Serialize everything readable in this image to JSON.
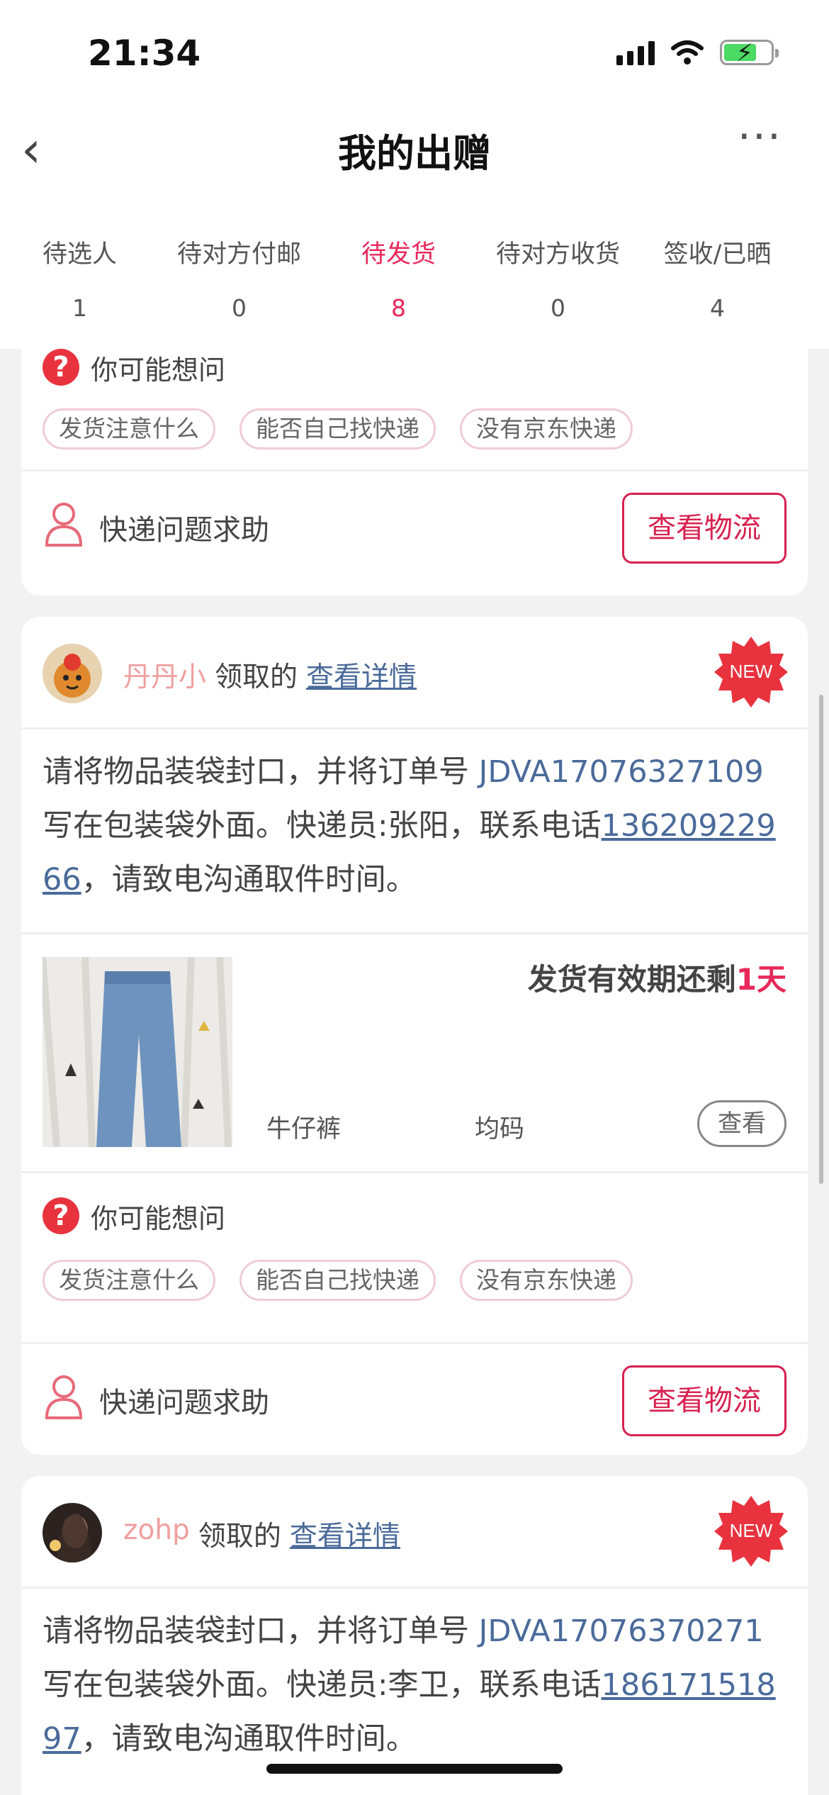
{
  "status": {
    "time": "21:34"
  },
  "nav": {
    "title": "我的出赠"
  },
  "tabs": [
    {
      "label": "待选人",
      "count": "1"
    },
    {
      "label": "待对方付邮",
      "count": "0"
    },
    {
      "label": "待发货",
      "count": "8"
    },
    {
      "label": "待对方收货",
      "count": "0"
    },
    {
      "label": "签收/已晒",
      "count": "4"
    }
  ],
  "card0": {
    "ask_title": "你可能想问",
    "chips": [
      "发货注意什么",
      "能否自己找快递",
      "没有京东快递"
    ],
    "help_label": "快递问题求助",
    "logistics_label": "查看物流"
  },
  "card1": {
    "user": "丹丹小",
    "claimed": "领取的",
    "detail": "查看详情",
    "badge": "NEW",
    "instr_a": "请将物品装袋封口，并将订单号 ",
    "order": "JDVA17076327109",
    "instr_b": " 写在包装袋外面。快递员:张阳，联系电话",
    "phone": "13620922966",
    "instr_c": "，请致电沟通取件时间。",
    "deadline_pre": "发货有效期还剩",
    "deadline_days": "1天",
    "item_name": "牛仔裤",
    "item_size": "均码",
    "view": "查看",
    "ask_title": "你可能想问",
    "chips": [
      "发货注意什么",
      "能否自己找快递",
      "没有京东快递"
    ],
    "help_label": "快递问题求助",
    "logistics_label": "查看物流"
  },
  "card2": {
    "user": "zohp",
    "claimed": "领取的",
    "detail": "查看详情",
    "badge": "NEW",
    "instr_a": "请将物品装袋封口，并将订单号 ",
    "order": "JDVA17076370271",
    "instr_b": " 写在包装袋外面。快递员:李卫，联系电话",
    "phone": "18617151897",
    "instr_c": "，请致电沟通取件时间。"
  },
  "colors": {
    "accent": "#e8285a",
    "link": "#4a6b9a"
  }
}
